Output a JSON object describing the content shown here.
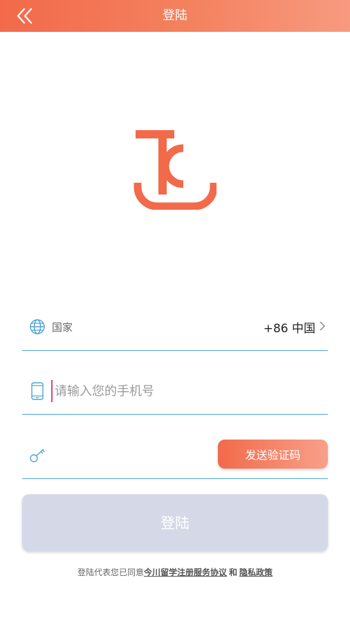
{
  "colors": {
    "header_start": "#f26a4a",
    "header_end": "#f79a80",
    "accent": "#f26a4a",
    "divider": "#4aa3d4",
    "login_disabled_bg": "#d5d9e7"
  },
  "header": {
    "title": "登陆",
    "back_icon": "double-chevron-left-icon"
  },
  "logo": {
    "icon": "jc-logo"
  },
  "form": {
    "country": {
      "label": "国家",
      "value": "+86 中国",
      "icon": "globe-icon"
    },
    "phone": {
      "placeholder": "请输入您的手机号",
      "value": "",
      "icon": "phone-icon"
    },
    "code": {
      "value": "",
      "icon": "key-icon",
      "send_label": "发送验证码"
    },
    "login_label": "登陆"
  },
  "agreement": {
    "prefix": "登陆代表您已同意",
    "terms_link": "今川留学注册服务协议",
    "and": "和",
    "privacy_link": "隐私政策"
  }
}
